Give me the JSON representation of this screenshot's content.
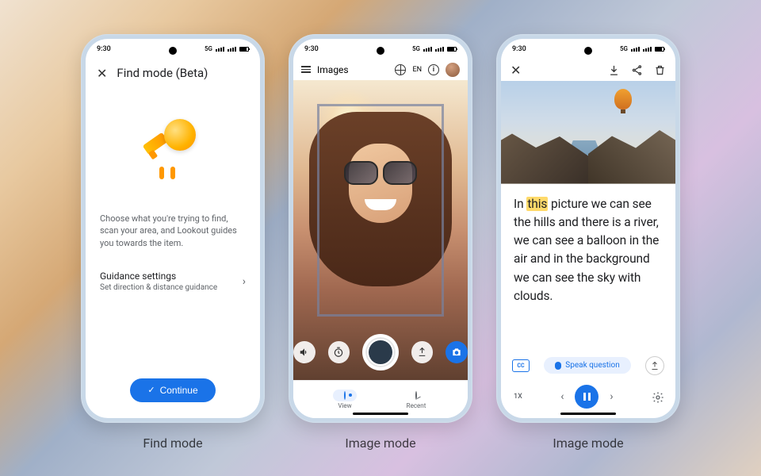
{
  "status": {
    "time": "9:30",
    "network": "5G"
  },
  "captions": {
    "p1": "Find mode",
    "p2": "Image mode",
    "p3": "Image mode"
  },
  "phone1": {
    "title": "Find mode (Beta)",
    "description": "Choose what you're trying to find, scan your area, and Lookout guides you towards the item.",
    "setting_title": "Guidance settings",
    "setting_sub": "Set direction & distance guidance",
    "continue": "Continue"
  },
  "phone2": {
    "header_label": "Images",
    "lang": "EN",
    "tab_view": "View",
    "tab_recent": "Recent"
  },
  "phone3": {
    "caption_full": "In this picture we can see the hills and there is a river, we can see a balloon in the air and in the background we can see the sky with clouds.",
    "caption_pre": "In ",
    "caption_hl": "this",
    "caption_post": " picture we can see the hills and there is a river, we can see a balloon in the air and in the background we can see the sky with clouds.",
    "speak": "Speak question",
    "zoom": "1X",
    "cc": "CC"
  }
}
